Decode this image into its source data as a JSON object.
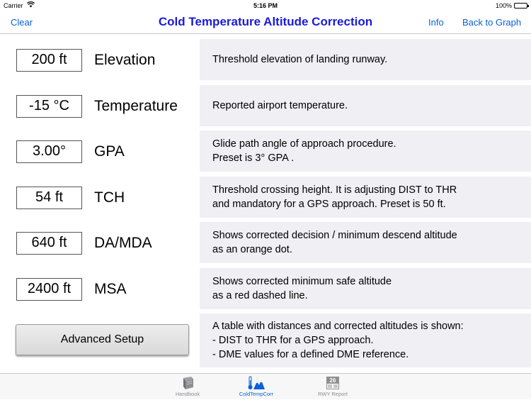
{
  "status_bar": {
    "carrier": "Carrier",
    "wifi_icon": "wifi-icon",
    "time": "5:16 PM",
    "battery": "100%"
  },
  "navbar": {
    "clear": "Clear",
    "title": "Cold Temperature Altitude Correction",
    "info": "Info",
    "back": "Back to Graph",
    "accent_color": "#0a60d8",
    "title_color": "#1a1ad8"
  },
  "rows": [
    {
      "value": "200 ft",
      "label": "Elevation",
      "description": "Threshold elevation of landing runway."
    },
    {
      "value": "-15 °C",
      "label": "Temperature",
      "description": "Reported airport temperature."
    },
    {
      "value": "3.00°",
      "label": "GPA",
      "description": "Glide path angle of approach procedure.\nPreset is 3° GPA ."
    },
    {
      "value": "54 ft",
      "label": "TCH",
      "description": "Threshold crossing height. It is adjusting DIST to THR\nand mandatory for a GPS approach. Preset is 50 ft."
    },
    {
      "value": "640 ft",
      "label": "DA/MDA",
      "description": "Shows corrected decision / minimum descend altitude\nas an orange dot."
    },
    {
      "value": "2400 ft",
      "label": "MSA",
      "description": "Shows corrected minimum safe altitude\nas a red dashed line."
    }
  ],
  "advanced": {
    "button": "Advanced Setup",
    "description": "A table with distances and corrected altitudes is shown:\n - DIST to THR for a GPS approach.\n - DME values for a defined DME reference."
  },
  "tabbar": {
    "tabs": [
      {
        "label": "Handbook",
        "icon": "book-icon",
        "active": false
      },
      {
        "label": "ColdTempCorr",
        "icon": "thermometer-mountains-icon",
        "active": true
      },
      {
        "label": "RWY Report",
        "icon": "runway-calendar-icon",
        "badge": "26",
        "active": false
      }
    ]
  },
  "colors": {
    "description_background": "#efeff4",
    "inactive_tab": "#8e8e93"
  }
}
